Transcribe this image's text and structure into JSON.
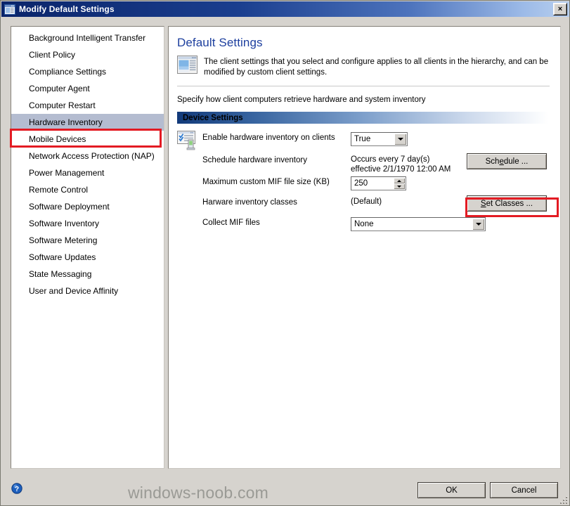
{
  "window": {
    "title": "Modify Default Settings",
    "title_icon": "dialog-window-icon",
    "close_label": "×"
  },
  "sidebar": {
    "items": [
      {
        "label": "Background Intelligent Transfer",
        "selected": false
      },
      {
        "label": "Client Policy",
        "selected": false
      },
      {
        "label": "Compliance Settings",
        "selected": false
      },
      {
        "label": "Computer Agent",
        "selected": false
      },
      {
        "label": "Computer Restart",
        "selected": false
      },
      {
        "label": "Hardware Inventory",
        "selected": true
      },
      {
        "label": "Mobile Devices",
        "selected": false
      },
      {
        "label": "Network Access Protection (NAP)",
        "selected": false
      },
      {
        "label": "Power Management",
        "selected": false
      },
      {
        "label": "Remote Control",
        "selected": false
      },
      {
        "label": "Software Deployment",
        "selected": false
      },
      {
        "label": "Software Inventory",
        "selected": false
      },
      {
        "label": "Software Metering",
        "selected": false
      },
      {
        "label": "Software Updates",
        "selected": false
      },
      {
        "label": "State Messaging",
        "selected": false
      },
      {
        "label": "User and Device Affinity",
        "selected": false
      }
    ]
  },
  "content": {
    "page_title": "Default Settings",
    "description": "The client settings that you select and configure applies to all clients in the hierarchy, and can be modified by custom client settings.",
    "description_icon": "client-settings-icon",
    "specify_text": "Specify how client computers retrieve hardware and system inventory",
    "group_header": "Device Settings",
    "rows": [
      {
        "icon": "hardware-inventory-icon",
        "label": "Enable hardware inventory on clients",
        "control": "combo",
        "value": "True",
        "button": null
      },
      {
        "icon": null,
        "label": "Schedule hardware inventory",
        "control": "text",
        "value": "Occurs every 7 day(s) effective 2/1/1970 12:00 AM",
        "button": {
          "label_pre": "Sch",
          "label_accel": "e",
          "label_post": "dule ...",
          "name": "schedule-button"
        }
      },
      {
        "icon": null,
        "label": "Maximum custom MIF file size (KB)",
        "control": "spin",
        "value": "250",
        "button": null
      },
      {
        "icon": null,
        "label": "Harware inventory classes",
        "control": "text",
        "value": "(Default)",
        "button": {
          "label_pre": "",
          "label_accel": "S",
          "label_post": "et Classes ...",
          "name": "set-classes-button"
        }
      },
      {
        "icon": null,
        "label": "Collect MIF files",
        "control": "combo-wide",
        "value": "None",
        "button": null
      }
    ]
  },
  "footer": {
    "help_icon": "help-question-icon",
    "watermark": "windows-noob.com",
    "ok_label": "OK",
    "cancel_label": "Cancel",
    "grip_icon": "resize-grip-icon"
  },
  "annotations": {
    "highlight_color": "#e31b23",
    "selection_color": "#b4bcd0",
    "title_accent": "#0a246a",
    "heading_color": "#1d3f9e"
  }
}
